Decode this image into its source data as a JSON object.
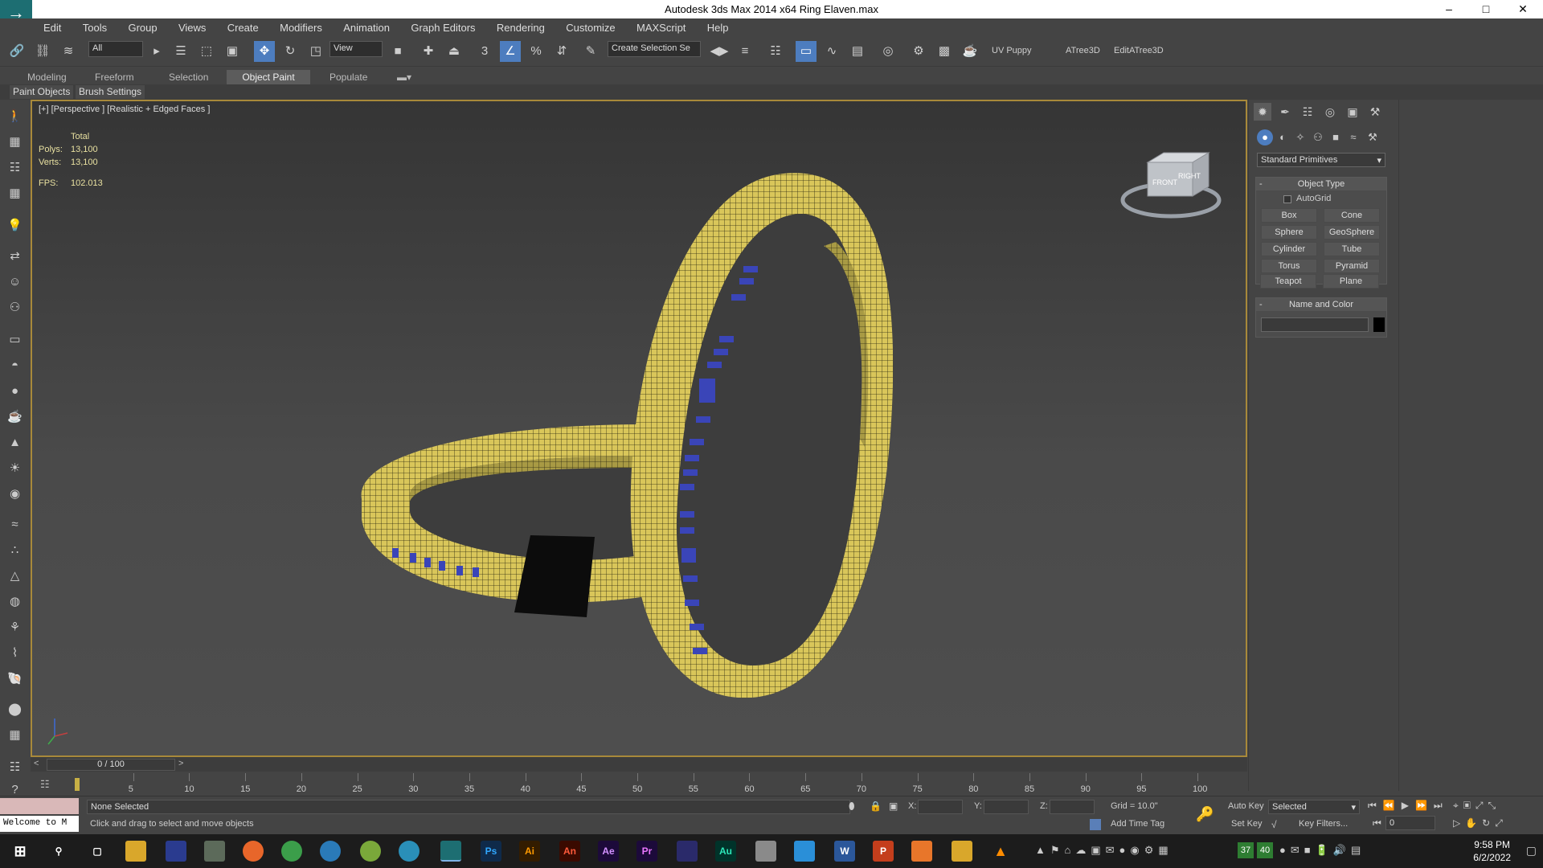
{
  "app": {
    "title": "Autodesk 3ds Max  2014 x64     Ring Elaven.max",
    "logo_letter": "→"
  },
  "window_controls": [
    "–",
    "□",
    "✕"
  ],
  "menu": [
    "Edit",
    "Tools",
    "Group",
    "Views",
    "Create",
    "Modifiers",
    "Animation",
    "Graph Editors",
    "Rendering",
    "Customize",
    "MAXScript",
    "Help"
  ],
  "toolbar": {
    "selection_filter": "All",
    "ref_coord": "View",
    "snap_3": "3",
    "named_selection": "Create Selection Se",
    "uv_puppy": "UV Puppy",
    "atree": "ATree3D",
    "editatree": "EditATree3D"
  },
  "ribbon_tabs": [
    "Modeling",
    "Freeform",
    "Selection",
    "Object Paint",
    "Populate"
  ],
  "ribbon_active": "Object Paint",
  "sub_tabs": [
    "Paint Objects",
    "Brush Settings"
  ],
  "viewport": {
    "label": "[+] [Perspective ] [Realistic + Edged Faces ]",
    "stats_header": "Total",
    "polys_label": "Polys:",
    "polys": "13,100",
    "verts_label": "Verts:",
    "verts": "13,100",
    "fps_label": "FPS:",
    "fps": "102.013",
    "navcube_right": "RIGHT",
    "navcube_front": "FRONT"
  },
  "command_panel": {
    "category": "Standard Primitives",
    "object_type_header": "Object Type",
    "autogrid": "AutoGrid",
    "buttons": [
      "Box",
      "Cone",
      "Sphere",
      "GeoSphere",
      "Cylinder",
      "Tube",
      "Torus",
      "Pyramid",
      "Teapot",
      "Plane"
    ],
    "name_color_header": "Name and Color"
  },
  "timeline": {
    "slider": "0 / 100",
    "ticks": [
      "5",
      "10",
      "15",
      "20",
      "25",
      "30",
      "35",
      "40",
      "45",
      "50",
      "55",
      "60",
      "65",
      "70",
      "75",
      "80",
      "85",
      "90",
      "95",
      "100"
    ]
  },
  "status": {
    "maxscript": "Welcome to M",
    "selection": "None Selected",
    "prompt": "Click and drag to select and move objects",
    "x_label": "X:",
    "y_label": "Y:",
    "z_label": "Z:",
    "grid": "Grid = 10.0\"",
    "add_time_tag": "Add Time Tag",
    "auto_key": "Auto Key",
    "set_key": "Set Key",
    "selected": "Selected",
    "key_filters": "Key Filters...",
    "frame": "0"
  },
  "taskbar": {
    "apps": [
      "Ps",
      "Ai",
      "An",
      "Ae",
      "Pr",
      "Au",
      "W",
      "P"
    ],
    "time": "9:58 PM",
    "date": "6/2/2022",
    "tray_numbers": [
      "37",
      "40"
    ]
  },
  "colors": {
    "ring": "#d9c65a",
    "wire": "#2a2810",
    "accent_blue": "#4d7dbf",
    "viewport_border": "#a8893a"
  }
}
